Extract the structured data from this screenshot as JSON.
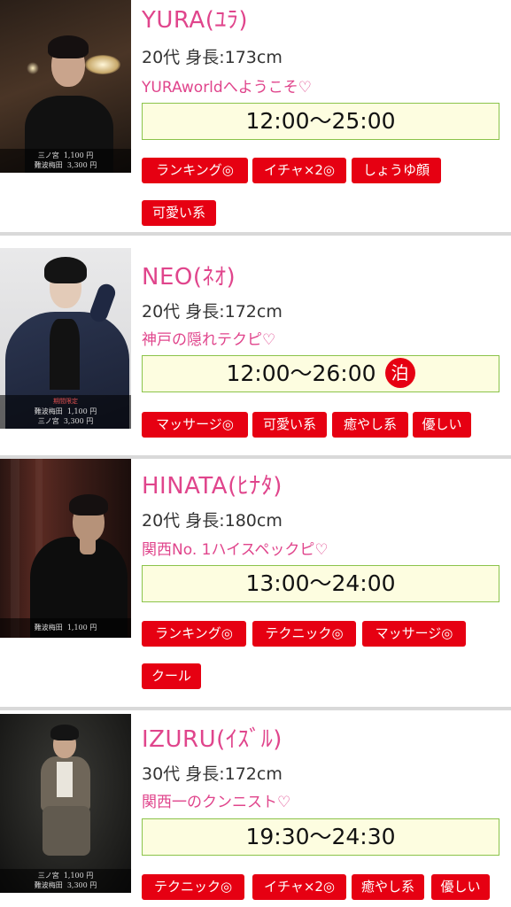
{
  "hosts": [
    {
      "name": "YURA(ﾕﾗ)",
      "stats": "20代 身長:173cm",
      "catch": "YURAworldへようこそ♡",
      "hours": "12:00〜25:00",
      "tags": [
        "ランキング◎",
        "イチャ×2◎",
        "しょうゆ顔",
        "可愛い系"
      ],
      "prices": [
        {
          "area": "三ノ宮",
          "price": "1,100 円"
        },
        {
          "area": "難波梅田",
          "price": "3,300 円"
        }
      ]
    },
    {
      "name": "NEO(ﾈｵ)",
      "stats": "20代 身長:172cm",
      "catch": "神戸の隠れテクピ♡",
      "hours": "12:00〜26:00",
      "stay_badge": "泊",
      "tags": [
        "マッサージ◎",
        "可愛い系",
        "癒やし系",
        "優しい"
      ],
      "price_note": "期間限定",
      "prices": [
        {
          "area": "難波梅田",
          "price": "1,100 円"
        },
        {
          "area": "三ノ宮",
          "price": "3,300 円"
        }
      ]
    },
    {
      "name": "HINATA(ﾋﾅﾀ)",
      "stats": "20代 身長:180cm",
      "catch": "関西No. 1ハイスペックピ♡",
      "hours": "13:00〜24:00",
      "tags": [
        "ランキング◎",
        "テクニック◎",
        "マッサージ◎",
        "クール"
      ],
      "prices": [
        {
          "area": "難波梅田",
          "price": "1,100 円"
        }
      ]
    },
    {
      "name": "IZURU(ｲｽﾞﾙ)",
      "stats": "30代 身長:172cm",
      "catch": "関西一のクンニスト♡",
      "hours": "19:30〜24:30",
      "tags": [
        "テクニック◎",
        "イチャ×2◎",
        "癒やし系",
        "優しい"
      ],
      "prices": [
        {
          "area": "三ノ宮",
          "price": "1,100 円"
        },
        {
          "area": "難波梅田",
          "price": "3,300 円"
        }
      ]
    }
  ],
  "colors": {
    "accent_pink": "#e0458c",
    "tag_red": "#e60012",
    "hours_bg": "#fdfde0",
    "hours_border": "#8bc34a"
  }
}
